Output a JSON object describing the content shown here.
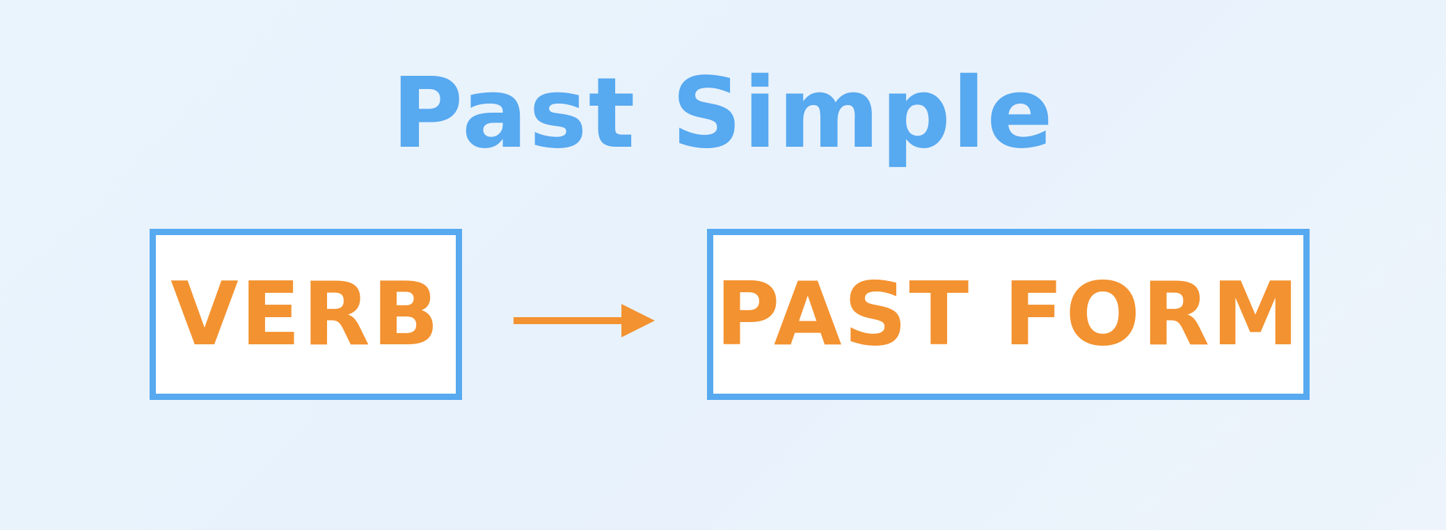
{
  "colors": {
    "title": "#57a9f0",
    "border": "#57a9f0",
    "label": "#f39230",
    "arrow": "#f39230"
  },
  "title": "Past Simple",
  "diagram": {
    "source_label": "VERB",
    "target_label": "PAST FORM",
    "connector_icon": "right-arrow-icon"
  }
}
